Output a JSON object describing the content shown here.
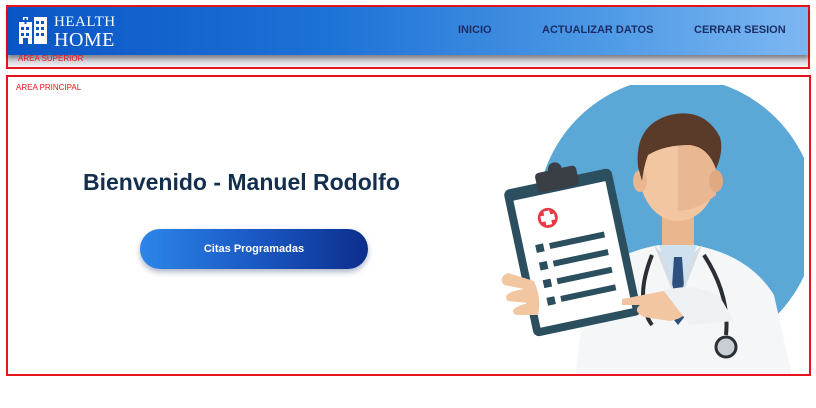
{
  "header": {
    "logo_line1": "HEALTH",
    "logo_line2": "HOME",
    "area_label": "AREA SUPERIOR",
    "nav": [
      {
        "label": "INICIO"
      },
      {
        "label": "ACTUALIZAR DATOS"
      },
      {
        "label": "CERRAR SESION"
      }
    ]
  },
  "main": {
    "area_label": "AREA PRINCIPAL",
    "welcome": "Bienvenido - Manuel Rodolfo",
    "appointments_button": "Citas Programadas"
  },
  "colors": {
    "header_gradient_start": "#0a55c6",
    "header_gradient_end": "#7db7f2",
    "area_border": "#e8141c",
    "nav_text": "#1a2e64",
    "welcome_text": "#132f4d",
    "button_start": "#2c86e8",
    "button_end": "#0c2e8c",
    "illustration_circle": "#5ba8d6"
  },
  "icons": {
    "logo": "hospital-building-icon",
    "illustration": "doctor-with-clipboard-illustration"
  }
}
